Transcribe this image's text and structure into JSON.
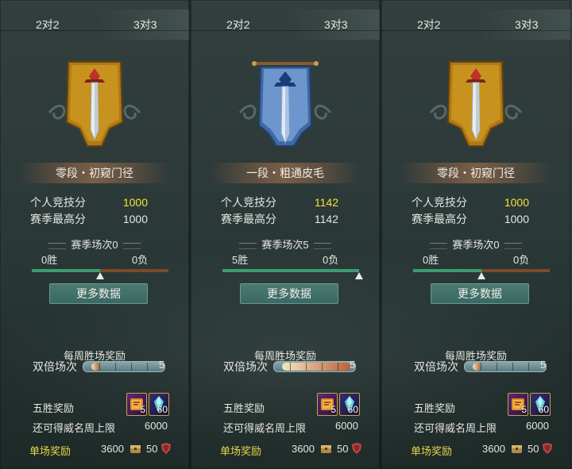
{
  "panels": [
    {
      "tabs": {
        "left": "2对2",
        "right": "3对3"
      },
      "active_tab": "3对3",
      "rank": "零段・初窥门径",
      "emblem": "gold-banner-sword",
      "personal_score_label": "个人竞技分",
      "personal_score": "1000",
      "season_high_label": "赛季最高分",
      "season_high": "1000",
      "season_matches": "赛季场次0",
      "wins": "0胜",
      "losses": "0负",
      "win_ratio": 0.5,
      "more_button": "更多数据",
      "weekly_reward_title": "每周胜场奖励",
      "double_label": "双倍场次",
      "double_count": "5",
      "double_progress": 0.0,
      "five_win_label": "五胜奖励",
      "item1_count": "5",
      "item2_count": "60",
      "weekly_cap_label": "还可得威名周上限",
      "weekly_cap": "6000",
      "single_reward_label": "单场奖励",
      "single_coin": "3600",
      "single_shield": "50"
    },
    {
      "tabs": {
        "left": "2对2",
        "right": "3对3"
      },
      "active_tab": "3对3",
      "rank": "一段・粗通皮毛",
      "emblem": "blue-banner-sword",
      "personal_score_label": "个人竞技分",
      "personal_score": "1142",
      "season_high_label": "赛季最高分",
      "season_high": "1142",
      "season_matches": "赛季场次5",
      "wins": "5胜",
      "losses": "0负",
      "win_ratio": 1.0,
      "more_button": "更多数据",
      "weekly_reward_title": "每周胜场奖励",
      "double_label": "双倍场次",
      "double_count": "5",
      "double_progress": 1.0,
      "five_win_label": "五胜奖励",
      "item1_count": "5",
      "item2_count": "60",
      "weekly_cap_label": "还可得威名周上限",
      "weekly_cap": "6000",
      "single_reward_label": "单场奖励",
      "single_coin": "3600",
      "single_shield": "50"
    },
    {
      "tabs": {
        "left": "2对2",
        "right": "3对3"
      },
      "active_tab": "3对3",
      "rank": "零段・初窥门径",
      "emblem": "gold-banner-sword",
      "personal_score_label": "个人竞技分",
      "personal_score": "1000",
      "season_high_label": "赛季最高分",
      "season_high": "1000",
      "season_matches": "赛季场次0",
      "wins": "0胜",
      "losses": "0负",
      "win_ratio": 0.5,
      "more_button": "更多数据",
      "weekly_reward_title": "每周胜场奖励",
      "double_label": "双倍场次",
      "double_count": "5",
      "double_progress": 0.0,
      "five_win_label": "五胜奖励",
      "item1_count": "5",
      "item2_count": "60",
      "weekly_cap_label": "还可得威名周上限",
      "weekly_cap": "6000",
      "single_reward_label": "单场奖励",
      "single_coin": "3600",
      "single_shield": "50"
    }
  ],
  "colors": {
    "gold_text": "#f2e23a",
    "single_reward_label": "#e7d74a",
    "win_track": "#3e9b73",
    "loss_track": "#7a4a2a"
  }
}
